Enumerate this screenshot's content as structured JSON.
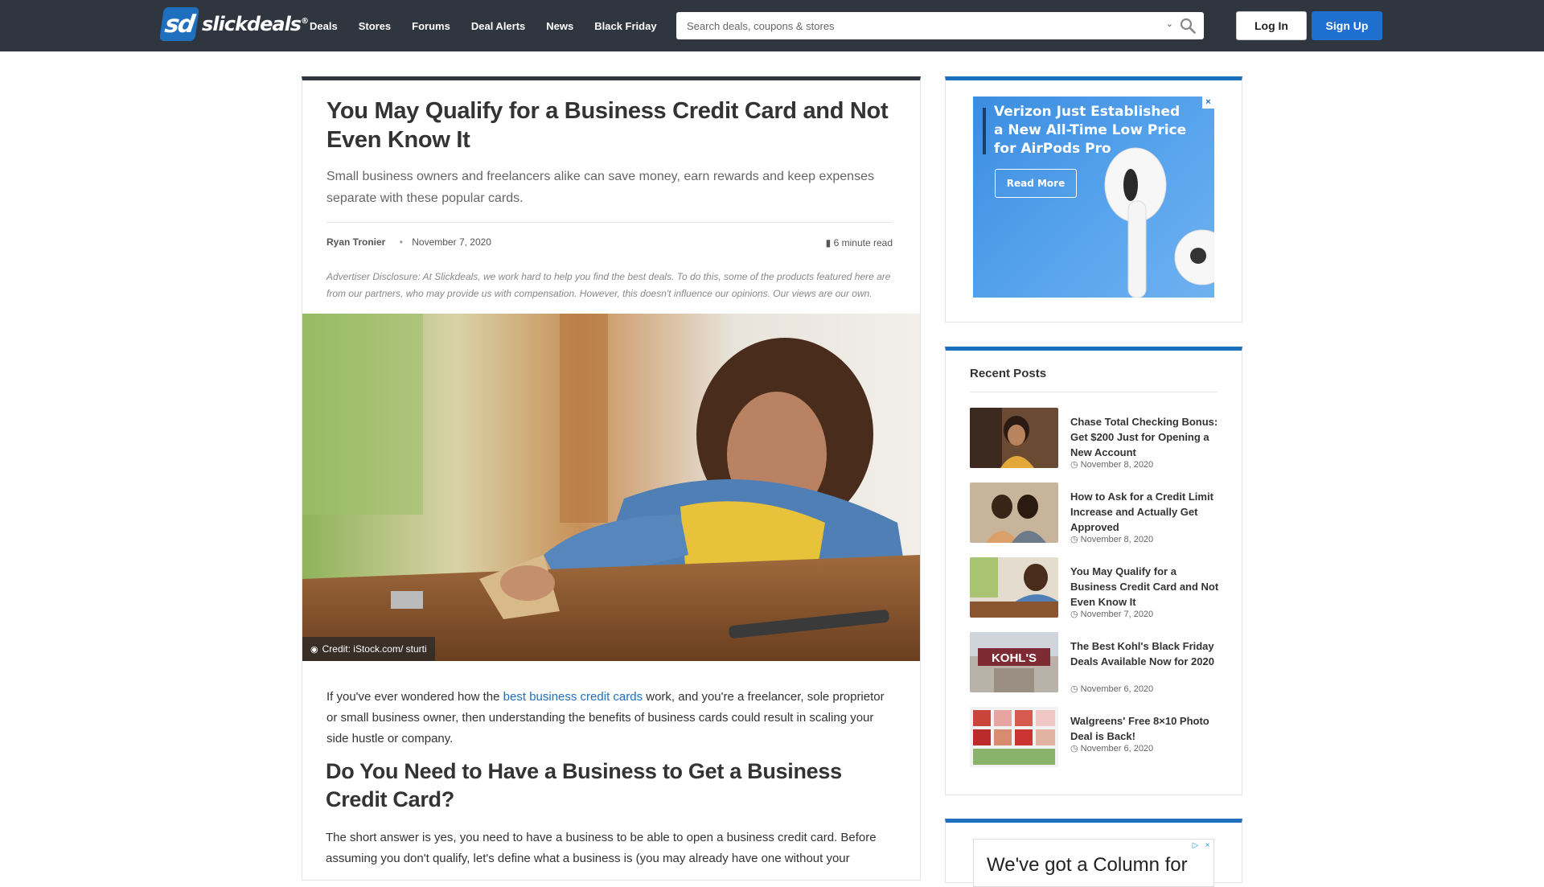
{
  "header": {
    "logo_mark": "sd",
    "logo_text": "slickdeals",
    "logo_reg": "®",
    "nav": [
      "Deals",
      "Stores",
      "Forums",
      "Deal Alerts",
      "News",
      "Black Friday"
    ],
    "search_placeholder": "Search deals, coupons & stores",
    "login_label": "Log In",
    "signup_label": "Sign Up"
  },
  "article": {
    "title": "You May Qualify for a Business Credit Card and Not Even Know It",
    "subtitle": "Small business owners and freelancers alike can save money, earn rewards and keep expenses separate with these popular cards.",
    "author": "Ryan Tronier",
    "date": "November 7, 2020",
    "read_time": "6 minute read",
    "disclosure": "Advertiser Disclosure: At Slickdeals, we work hard to help you find the best deals. To do this, some of the products featured here are from our partners, who may provide us with compensation. However, this doesn't influence our opinions. Our views are our own.",
    "image_credit": "Credit: iStock.com/ sturti",
    "para1_before": "If you've ever wondered how the ",
    "para1_link": "best business credit cards",
    "para1_after": " work, and you're a freelancer, sole proprietor or small business owner, then understanding the benefits of business cards could result in scaling your side hustle or company.",
    "heading2": "Do You Need to Have a Business to Get a Business Credit Card?",
    "para2": "The short answer is yes, you need to have a business to be able to open a business credit card. Before assuming you don't qualify, let's define what a business is (you may already have one without your"
  },
  "sidebar": {
    "ad1": {
      "headline": "Verizon Just Established a New All-Time Low Price for AirPods Pro",
      "button": "Read More",
      "close": "×"
    },
    "recent_title": "Recent Posts",
    "posts": [
      {
        "title": "Chase Total Checking Bonus: Get $200 Just for Opening a New Account",
        "date": "November 8, 2020"
      },
      {
        "title": "How to Ask for a Credit Limit Increase and Actually Get Approved",
        "date": "November 8, 2020"
      },
      {
        "title": "You May Qualify for a Business Credit Card and Not Even Know It",
        "date": "November 7, 2020"
      },
      {
        "title": "The Best Kohl's Black Friday Deals Available Now for 2020",
        "date": "November 6, 2020"
      },
      {
        "title": "Walgreens' Free 8×10 Photo Deal is Back!",
        "date": "November 6, 2020"
      }
    ],
    "ad3": {
      "text": "We've got a Column for",
      "choice_icon": "▷",
      "close": "×"
    },
    "thumb_kohls_text": "KOHL'S"
  },
  "colors": {
    "header_bg": "#2f3640",
    "accent_blue": "#1f6fbf",
    "signup_blue": "#1f6fcf"
  }
}
